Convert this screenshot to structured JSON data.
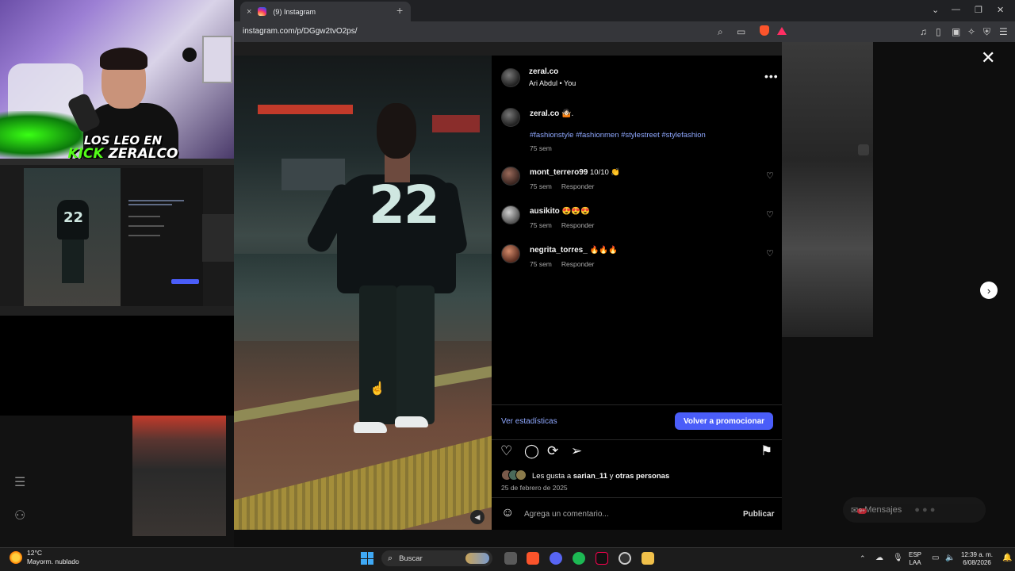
{
  "webcam": {
    "logo_line1": "LOS LEO EN",
    "logo_kick": "KICK",
    "logo_name": "ZERALCO"
  },
  "browser": {
    "tab_title": "(9) Instagram",
    "tab_close": "×",
    "new_tab": "+",
    "url": "instagram.com/p/DGgw2tvO2ps/"
  },
  "post": {
    "author": "zeral.co",
    "collab": "Ari Abdul",
    "collab_sep": "•",
    "collab_you": "You",
    "more": "•••",
    "caption_user": "zeral.co",
    "caption_emoji": "🤷🏻",
    "caption_dot": ".",
    "hashtags": "#fashionstyle #fashionmen #stylestreet #stylefashion",
    "caption_time": "75 sem",
    "comments": [
      {
        "user": "mont_terrero99",
        "text": "10/10 👏",
        "time": "75 sem",
        "reply": "Responder"
      },
      {
        "user": "ausikito",
        "text": "😍😍😍",
        "time": "75 sem",
        "reply": "Responder"
      },
      {
        "user": "negrita_torres_",
        "text": "🔥🔥🔥",
        "time": "75 sem",
        "reply": "Responder"
      }
    ],
    "stats_link": "Ver estadísticas",
    "promote_button": "Volver a promocionar",
    "likes_prefix": "Les gusta a",
    "likes_user": "sarian_11",
    "likes_mid": "y",
    "likes_others": "otras personas",
    "date": "25 de febrero de 2025",
    "comment_placeholder": "Agrega un comentario...",
    "publish": "Publicar",
    "emoji_icon": "☺"
  },
  "photo": {
    "jersey_number": "22"
  },
  "overlay": {
    "messages": "Mensajes",
    "messages_badge": "9+"
  },
  "taskbar": {
    "temp": "12°C",
    "weather": "Mayorm. nublado",
    "search": "Buscar",
    "lang1": "ESP",
    "lang2": "LAA",
    "time": "12:39 a. m.",
    "date": "6/08/2026"
  },
  "colors": {
    "accent": "#4a5df9",
    "link": "#8fa8ff",
    "kick_green": "#53fc18"
  }
}
